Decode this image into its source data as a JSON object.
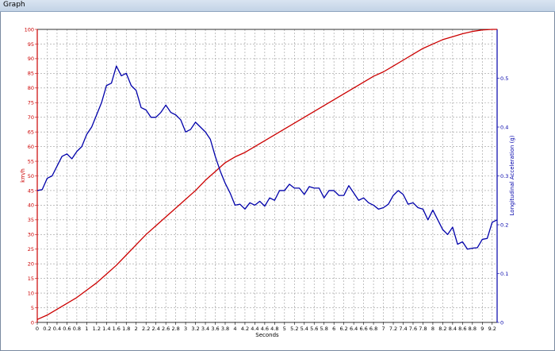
{
  "window": {
    "title": "Graph"
  },
  "colors": {
    "speed": "#cc0000",
    "accel": "#0000aa",
    "grid": "#9a9a9a",
    "axis_left": "#cc0000",
    "axis_right": "#0000aa"
  },
  "chart_data": {
    "type": "line",
    "title": "",
    "xlabel": "Seconds",
    "ylabel_left": "km/h",
    "ylabel_right": "Longitudinal Acceleration (g)",
    "xlim": [
      0,
      9.3
    ],
    "ylim_left": [
      0,
      100
    ],
    "ylim_right": [
      0,
      0.6
    ],
    "grid": true,
    "x_ticks": [
      "0",
      "0.2",
      "0.4",
      "0.6",
      "0.8",
      "1",
      "1.2",
      "1.4",
      "1.6",
      "1.8",
      "2",
      "2.2",
      "2.4",
      "2.6",
      "2.8",
      "3",
      "3.2",
      "3.4",
      "3.6",
      "3.8",
      "4",
      "4.2",
      "4.4",
      "4.6",
      "4.8",
      "5",
      "5.2",
      "5.4",
      "5.6",
      "5.8",
      "6",
      "6.2",
      "6.4",
      "6.6",
      "6.8",
      "7",
      "7.2",
      "7.4",
      "7.6",
      "7.8",
      "8",
      "8.2",
      "8.4",
      "8.6",
      "8.8",
      "9",
      "9.2"
    ],
    "y_left_ticks": [
      "0",
      "5",
      "10",
      "15",
      "20",
      "25",
      "30",
      "35",
      "40",
      "45",
      "50",
      "55",
      "60",
      "65",
      "70",
      "75",
      "80",
      "85",
      "90",
      "95",
      "100"
    ],
    "y_right_ticks": [
      "0",
      "0.1",
      "0.2",
      "0.3",
      "0.4",
      "0.5"
    ],
    "series": [
      {
        "name": "km/h",
        "axis": "left",
        "x": [
          0,
          0.2,
          0.4,
          0.6,
          0.8,
          1,
          1.2,
          1.4,
          1.6,
          1.8,
          2,
          2.2,
          2.4,
          2.6,
          2.8,
          3,
          3.2,
          3.4,
          3.6,
          3.8,
          4,
          4.2,
          4.4,
          4.6,
          4.8,
          5,
          5.2,
          5.4,
          5.6,
          5.8,
          6,
          6.2,
          6.4,
          6.6,
          6.8,
          7,
          7.2,
          7.4,
          7.6,
          7.8,
          8,
          8.2,
          8.4,
          8.6,
          8.8,
          9,
          9.2,
          9.3
        ],
        "values": [
          1,
          2.5,
          4.5,
          6.5,
          8.5,
          11,
          13.5,
          16.5,
          19.5,
          23,
          26.5,
          30,
          33,
          36,
          39,
          42,
          45,
          48.5,
          51.5,
          54.5,
          56.5,
          58,
          60,
          62,
          64,
          66,
          68,
          70,
          72,
          74,
          76,
          78,
          80,
          82,
          84,
          85.5,
          87.5,
          89.5,
          91.5,
          93.5,
          95,
          96.5,
          97.5,
          98.5,
          99.3,
          99.8,
          100,
          100
        ]
      },
      {
        "name": "Longitudinal Acceleration (g)",
        "axis": "right",
        "x": [
          0,
          0.1,
          0.2,
          0.3,
          0.4,
          0.5,
          0.6,
          0.7,
          0.8,
          0.9,
          1,
          1.1,
          1.2,
          1.3,
          1.4,
          1.5,
          1.6,
          1.7,
          1.8,
          1.9,
          2,
          2.1,
          2.2,
          2.3,
          2.4,
          2.5,
          2.6,
          2.7,
          2.8,
          2.9,
          3,
          3.1,
          3.2,
          3.3,
          3.4,
          3.5,
          3.6,
          3.7,
          3.8,
          3.9,
          4,
          4.1,
          4.2,
          4.3,
          4.4,
          4.5,
          4.6,
          4.7,
          4.8,
          4.9,
          5,
          5.1,
          5.2,
          5.3,
          5.4,
          5.5,
          5.6,
          5.7,
          5.8,
          5.9,
          6,
          6.1,
          6.2,
          6.3,
          6.4,
          6.5,
          6.6,
          6.7,
          6.8,
          6.9,
          7,
          7.1,
          7.2,
          7.3,
          7.4,
          7.5,
          7.6,
          7.7,
          7.8,
          7.9,
          8,
          8.1,
          8.2,
          8.3,
          8.4,
          8.5,
          8.6,
          8.7,
          8.8,
          8.9,
          9,
          9.1,
          9.2,
          9.3
        ],
        "values": [
          0.27,
          0.272,
          0.295,
          0.3,
          0.32,
          0.34,
          0.345,
          0.335,
          0.35,
          0.36,
          0.385,
          0.4,
          0.425,
          0.45,
          0.485,
          0.49,
          0.525,
          0.505,
          0.51,
          0.485,
          0.475,
          0.44,
          0.435,
          0.42,
          0.42,
          0.43,
          0.445,
          0.43,
          0.425,
          0.415,
          0.39,
          0.395,
          0.41,
          0.4,
          0.39,
          0.375,
          0.34,
          0.31,
          0.285,
          0.265,
          0.24,
          0.242,
          0.232,
          0.245,
          0.24,
          0.248,
          0.238,
          0.255,
          0.25,
          0.27,
          0.27,
          0.283,
          0.275,
          0.275,
          0.262,
          0.278,
          0.275,
          0.275,
          0.255,
          0.27,
          0.27,
          0.26,
          0.26,
          0.28,
          0.265,
          0.25,
          0.255,
          0.245,
          0.24,
          0.232,
          0.235,
          0.242,
          0.26,
          0.27,
          0.262,
          0.242,
          0.245,
          0.235,
          0.232,
          0.21,
          0.23,
          0.21,
          0.19,
          0.18,
          0.195,
          0.16,
          0.165,
          0.15,
          0.152,
          0.153,
          0.17,
          0.172,
          0.205,
          0.21
        ]
      }
    ]
  }
}
